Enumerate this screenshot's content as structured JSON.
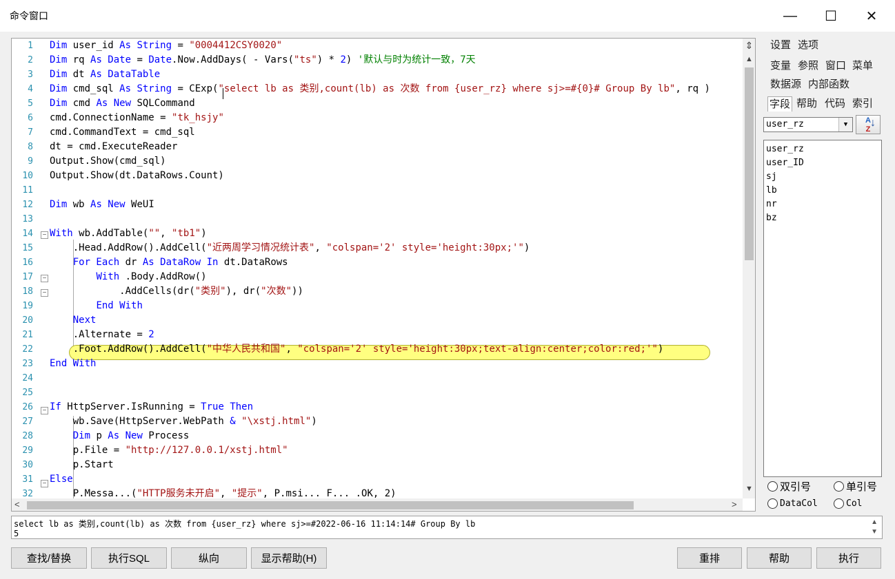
{
  "window": {
    "title": "命令窗口",
    "minimize_glyph": "—",
    "maximize_glyph": "☐",
    "close_glyph": "✕"
  },
  "editor": {
    "line_numbers": [
      "1",
      "2",
      "3",
      "4",
      "5",
      "6",
      "7",
      "8",
      "9",
      "10",
      "11",
      "12",
      "13",
      "14",
      "15",
      "16",
      "17",
      "18",
      "19",
      "20",
      "21",
      "22",
      "23",
      "24",
      "25",
      "26",
      "27",
      "28",
      "29",
      "30",
      "31",
      "32"
    ],
    "highlighted_line": "22",
    "code_lines": [
      [
        {
          "t": "Dim ",
          "c": "kw"
        },
        {
          "t": "user_id ",
          "c": ""
        },
        {
          "t": "As String ",
          "c": "kw"
        },
        {
          "t": "= ",
          "c": ""
        },
        {
          "t": "\"0004412CSY0020\"",
          "c": "str"
        }
      ],
      [
        {
          "t": "Dim ",
          "c": "kw"
        },
        {
          "t": "rq ",
          "c": ""
        },
        {
          "t": "As Date ",
          "c": "kw"
        },
        {
          "t": "= ",
          "c": ""
        },
        {
          "t": "Date",
          "c": "kw"
        },
        {
          "t": ".Now.AddDays( - Vars(",
          "c": ""
        },
        {
          "t": "\"ts\"",
          "c": "str"
        },
        {
          "t": ") * ",
          "c": ""
        },
        {
          "t": "2",
          "c": "num"
        },
        {
          "t": ") ",
          "c": ""
        },
        {
          "t": "'默认与时为统计一致，7天",
          "c": "cmt"
        }
      ],
      [
        {
          "t": "Dim ",
          "c": "kw"
        },
        {
          "t": "dt ",
          "c": ""
        },
        {
          "t": "As DataTable",
          "c": "kw"
        }
      ],
      [
        {
          "t": "Dim ",
          "c": "kw"
        },
        {
          "t": "cmd_sql ",
          "c": ""
        },
        {
          "t": "As String ",
          "c": "kw"
        },
        {
          "t": "= CExp(",
          "c": ""
        },
        {
          "t": "\"select lb as 类别,count(lb) as 次数 from {user_rz} where sj>=#{0}# Group By lb\"",
          "c": "str"
        },
        {
          "t": ", rq )",
          "c": ""
        }
      ],
      [
        {
          "t": "Dim ",
          "c": "kw"
        },
        {
          "t": "cmd ",
          "c": ""
        },
        {
          "t": "As New ",
          "c": "kw"
        },
        {
          "t": "SQLCommand",
          "c": ""
        }
      ],
      [
        {
          "t": "cmd.ConnectionName = ",
          "c": ""
        },
        {
          "t": "\"tk_hsjy\"",
          "c": "str"
        }
      ],
      [
        {
          "t": "cmd.CommandText = cmd_sql",
          "c": ""
        }
      ],
      [
        {
          "t": "dt = cmd.ExecuteReader",
          "c": ""
        }
      ],
      [
        {
          "t": "Output.Show(cmd_sql)",
          "c": ""
        }
      ],
      [
        {
          "t": "Output.Show(dt.DataRows.Count)",
          "c": ""
        }
      ],
      [],
      [
        {
          "t": "Dim ",
          "c": "kw"
        },
        {
          "t": "wb ",
          "c": ""
        },
        {
          "t": "As New ",
          "c": "kw"
        },
        {
          "t": "WeUI",
          "c": ""
        }
      ],
      [],
      [
        {
          "t": "With ",
          "c": "kw"
        },
        {
          "t": "wb.AddTable(",
          "c": ""
        },
        {
          "t": "\"\"",
          "c": "str"
        },
        {
          "t": ", ",
          "c": ""
        },
        {
          "t": "\"tb1\"",
          "c": "str"
        },
        {
          "t": ")",
          "c": ""
        }
      ],
      [
        {
          "t": "    .Head.AddRow().AddCell(",
          "c": ""
        },
        {
          "t": "\"近两周学习情况统计表\"",
          "c": "str"
        },
        {
          "t": ", ",
          "c": ""
        },
        {
          "t": "\"colspan='2' style='height:30px;'\"",
          "c": "str"
        },
        {
          "t": ")",
          "c": ""
        }
      ],
      [
        {
          "t": "    ",
          "c": ""
        },
        {
          "t": "For Each ",
          "c": "kw"
        },
        {
          "t": "dr ",
          "c": ""
        },
        {
          "t": "As DataRow In ",
          "c": "kw"
        },
        {
          "t": "dt.DataRows",
          "c": ""
        }
      ],
      [
        {
          "t": "        ",
          "c": ""
        },
        {
          "t": "With ",
          "c": "kw"
        },
        {
          "t": ".Body.AddRow()",
          "c": ""
        }
      ],
      [
        {
          "t": "            .AddCells(dr(",
          "c": ""
        },
        {
          "t": "\"类别\"",
          "c": "str"
        },
        {
          "t": "), dr(",
          "c": ""
        },
        {
          "t": "\"次数\"",
          "c": "str"
        },
        {
          "t": "))",
          "c": ""
        }
      ],
      [
        {
          "t": "        ",
          "c": ""
        },
        {
          "t": "End With",
          "c": "kw"
        }
      ],
      [
        {
          "t": "    ",
          "c": ""
        },
        {
          "t": "Next",
          "c": "kw"
        }
      ],
      [
        {
          "t": "    .Alternate = ",
          "c": ""
        },
        {
          "t": "2",
          "c": "num"
        }
      ],
      [
        {
          "t": "    .Foot.AddRow().AddCell(",
          "c": ""
        },
        {
          "t": "\"中华人民共和国\"",
          "c": "str"
        },
        {
          "t": ", ",
          "c": ""
        },
        {
          "t": "\"colspan='2' style='height:30px;text-align:center;color:red;'\"",
          "c": "str"
        },
        {
          "t": ")",
          "c": ""
        }
      ],
      [
        {
          "t": "End With",
          "c": "kw"
        }
      ],
      [],
      [],
      [
        {
          "t": "If ",
          "c": "kw"
        },
        {
          "t": "HttpServer.IsRunning = ",
          "c": ""
        },
        {
          "t": "True Then",
          "c": "kw"
        }
      ],
      [
        {
          "t": "    wb.Save(HttpServer.WebPath ",
          "c": ""
        },
        {
          "t": "& ",
          "c": "kw"
        },
        {
          "t": "\"\\xstj.html\"",
          "c": "str"
        },
        {
          "t": ")",
          "c": ""
        }
      ],
      [
        {
          "t": "    ",
          "c": ""
        },
        {
          "t": "Dim ",
          "c": "kw"
        },
        {
          "t": "p ",
          "c": ""
        },
        {
          "t": "As New ",
          "c": "kw"
        },
        {
          "t": "Process",
          "c": ""
        }
      ],
      [
        {
          "t": "    p.File = ",
          "c": ""
        },
        {
          "t": "\"http://127.0.0.1/xstj.html\"",
          "c": "str"
        }
      ],
      [
        {
          "t": "    p.Start",
          "c": ""
        }
      ],
      [
        {
          "t": "Else",
          "c": "kw"
        }
      ],
      [
        {
          "t": "    P.Messa...(",
          "c": ""
        },
        {
          "t": "\"HTTP服务未开启\"",
          "c": "str"
        },
        {
          "t": ", ",
          "c": ""
        },
        {
          "t": "\"提示\"",
          "c": "str"
        },
        {
          "t": ", P.msi... F... .OK, 2)",
          "c": ""
        }
      ]
    ],
    "fold_marker": "−"
  },
  "sidebar": {
    "menu_row1": [
      "设置",
      "选项"
    ],
    "menu_row2": [
      "变量",
      "参照",
      "窗口",
      "菜单"
    ],
    "menu_row3": [
      "数据源",
      "内部函数"
    ],
    "tabs": [
      "字段",
      "帮助",
      "代码",
      "索引"
    ],
    "active_tab": "字段",
    "table_select": {
      "value": "user_rz",
      "arrow": "▼"
    },
    "sort_button": {
      "a": "A",
      "z": "Z",
      "arrow": "↓"
    },
    "fields": [
      "user_rz",
      "user_ID",
      "sj",
      "lb",
      "nr",
      "bz"
    ],
    "radios": [
      "双引号",
      "单引号",
      "DataCol",
      "Col"
    ]
  },
  "output": {
    "lines": [
      "select lb as 类别,count(lb) as 次数 from {user_rz} where sj>=#2022-06-16 11:14:14# Group By lb",
      "5"
    ]
  },
  "buttons": {
    "find_replace": "查找/替换",
    "exec_sql": "执行SQL",
    "vertical": "纵向",
    "show_help": "显示帮助(H)",
    "rearrange": "重排",
    "help": "帮助",
    "execute": "执行"
  },
  "scroll_glyphs": {
    "split": "⇕",
    "up": "▲",
    "down": "▼",
    "left": "<",
    "right": ">"
  }
}
